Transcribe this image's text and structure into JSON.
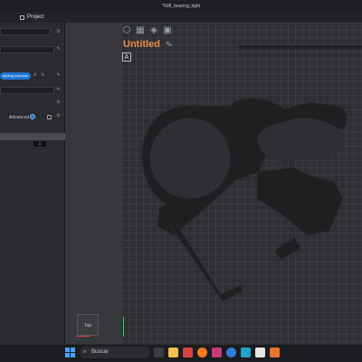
{
  "window": {
    "title": "*608_bearing_tight"
  },
  "project_tab": {
    "label": "Project"
  },
  "sidepanel": {
    "pill_label": "adding columns",
    "advanced_label": "Advanced",
    "number_value": "1"
  },
  "canvas": {
    "doc_title": "Untitled",
    "layer_badge": "A",
    "viewcube_label": "Top",
    "toolbar": [
      "cube-icon",
      "grid-icon",
      "ruler-icon",
      "image-icon"
    ]
  },
  "taskbar": {
    "search_placeholder": "Buscar",
    "apps": [
      {
        "name": "windows-start-icon"
      },
      {
        "name": "file-explorer-icon",
        "color": "#f2c14e"
      },
      {
        "name": "app-red-icon",
        "color": "#d64545"
      },
      {
        "name": "firefox-icon",
        "color": "#ff7a1a"
      },
      {
        "name": "app-magenta-icon",
        "color": "#c83a7a"
      },
      {
        "name": "app-blue-icon",
        "color": "#2f7fd8"
      },
      {
        "name": "app-cyan-icon",
        "color": "#1fa3c7"
      },
      {
        "name": "app-white-icon",
        "color": "#e6e6e6"
      },
      {
        "name": "app-orange-icon",
        "color": "#e8742a"
      }
    ]
  },
  "colors": {
    "accent": "#1f76d2",
    "title_orange": "#f08a4b",
    "canvas_bg": "#2e2f32"
  }
}
